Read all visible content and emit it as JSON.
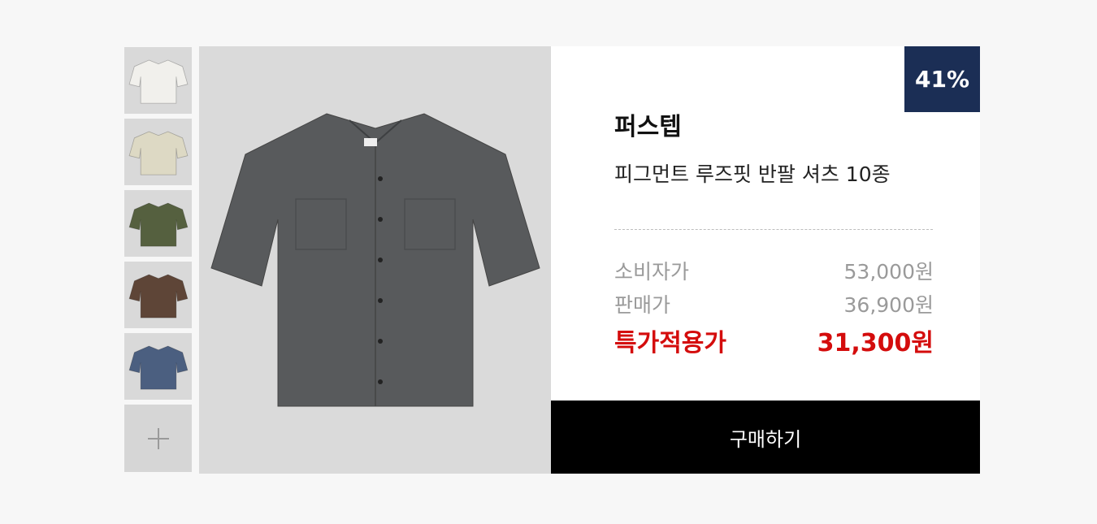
{
  "thumbnails": [
    {
      "label": "white-shirt",
      "color": "#f1f0ec"
    },
    {
      "label": "beige-shirt",
      "color": "#ddd9c4"
    },
    {
      "label": "khaki-shirt",
      "color": "#55603f"
    },
    {
      "label": "brown-shirt",
      "color": "#5e4537"
    },
    {
      "label": "blue-shirt",
      "color": "#4b5f80"
    }
  ],
  "main_image": {
    "color": "#585a5c"
  },
  "badge": {
    "discount": "41%"
  },
  "product": {
    "brand": "퍼스텝",
    "title": "피그먼트 루즈핏 반팔 셔츠 10종"
  },
  "prices": {
    "consumer": {
      "label": "소비자가",
      "value": "53,000원"
    },
    "sale": {
      "label": "판매가",
      "value": "36,900원"
    },
    "special": {
      "label": "특가적용가",
      "value": "31,300원"
    }
  },
  "buy_button": {
    "label": "구매하기"
  },
  "colors": {
    "badge_bg": "#1b2e55",
    "special_price": "#d40c0c",
    "button_bg": "#000000"
  }
}
